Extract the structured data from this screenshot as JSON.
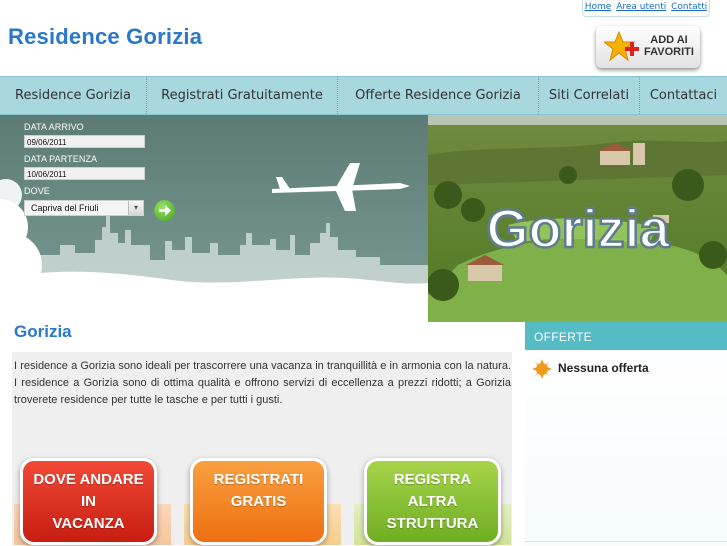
{
  "header": {
    "site_title": "Residence Gorizia",
    "top_links": [
      "Home",
      "Area utenti",
      "Contatti"
    ],
    "fav_button": {
      "line1": "ADD AI",
      "line2": "FAVORITI"
    }
  },
  "nav": {
    "items": [
      "Residence Gorizia",
      "Registrati Gratuitamente",
      "Offerte Residence Gorizia",
      "Siti Correlati",
      "Contattaci"
    ]
  },
  "search_form": {
    "arrivo_label": "DATA ARRIVO",
    "arrivo_value": "09/06/2011",
    "partenza_label": "DATA PARTENZA",
    "partenza_value": "10/06/2011",
    "dove_label": "DOVE",
    "dove_value": "Capriva del Friuli"
  },
  "banner": {
    "photo_caption": "Gorizia"
  },
  "main": {
    "heading": "Gorizia",
    "description": "I residence a Gorizia sono ideali per trascorrere una vacanza in tranquillità e in armonia con la natura. I residence a Gorizia sono di ottima qualità e offrono servizi di eccellenza a prezzi ridotti; a Gorizia troverete residence per tutte le tasche e per tutti i gusti.",
    "promos": [
      {
        "line1": "DOVE ANDARE",
        "line2": "IN",
        "line3": "VACANZA",
        "color": "#e42a1c"
      },
      {
        "line1": "REGISTRATI",
        "line2": "GRATIS",
        "line3": "",
        "color": "#f5821f"
      },
      {
        "line1": "REGISTRA",
        "line2": "ALTRA",
        "line3": "STRUTTURA",
        "color": "#8dc43b"
      }
    ]
  },
  "sidebar": {
    "title": "OFFERTE",
    "empty_text": "Nessuna offerta"
  },
  "colors": {
    "accent_blue": "#2a78c8",
    "nav_bg": "#a7d7df",
    "offerte_bar": "#55bcc6"
  }
}
